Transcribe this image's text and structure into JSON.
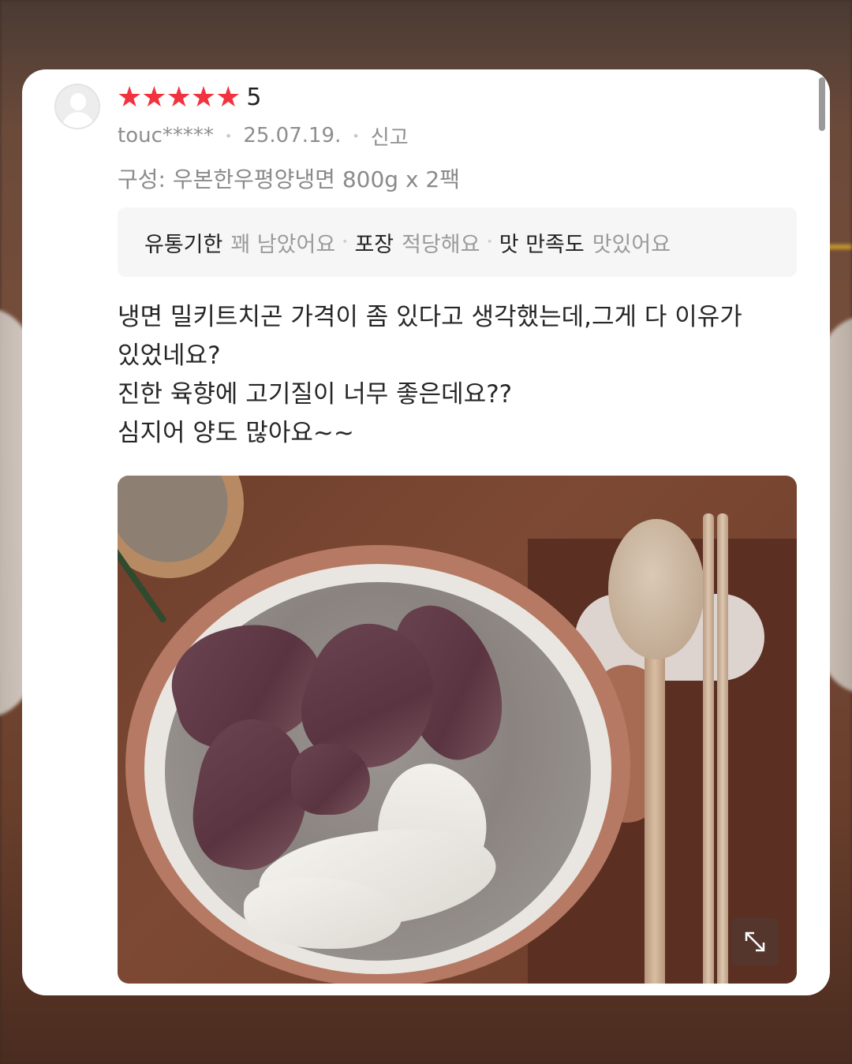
{
  "review": {
    "rating": {
      "stars": 5,
      "max_stars": 5,
      "value_label": "5",
      "star_color": "#f2333f"
    },
    "reviewer": "touc*****",
    "date": "25.07.19.",
    "report_label": "신고",
    "option": "구성: 우본한우평양냉면 800g x 2팩",
    "survey": [
      {
        "key": "유통기한",
        "value": "꽤 남았어요"
      },
      {
        "key": "포장",
        "value": "적당해요"
      },
      {
        "key": "맛 만족도",
        "value": "맛있어요"
      }
    ],
    "body_lines": [
      "냉면 밀키트치곤 가격이 좀 있다고 생각했는데,그게 다 이유가",
      "있었네요?",
      "진한 육향에 고기질이 너무 좋은데요??",
      "심지어 양도 많아요~~"
    ],
    "photo_icon": "expand-icon"
  }
}
